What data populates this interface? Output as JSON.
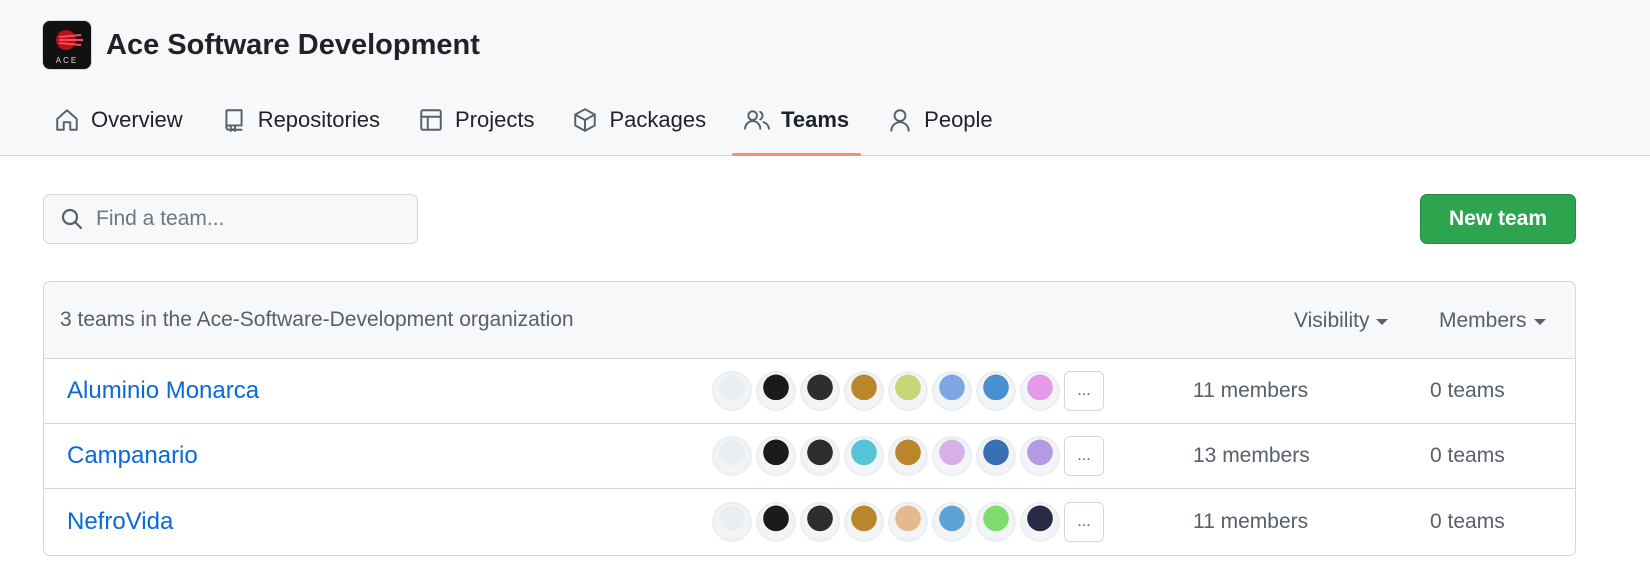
{
  "org": {
    "name": "Ace Software Development",
    "logo_text": "ACE"
  },
  "nav": [
    {
      "label": "Overview",
      "icon": "home-icon"
    },
    {
      "label": "Repositories",
      "icon": "repo-icon"
    },
    {
      "label": "Projects",
      "icon": "table-icon"
    },
    {
      "label": "Packages",
      "icon": "package-icon"
    },
    {
      "label": "Teams",
      "icon": "people-icon",
      "active": true
    },
    {
      "label": "People",
      "icon": "person-icon"
    }
  ],
  "search": {
    "placeholder": "Find a team..."
  },
  "new_team_label": "New team",
  "list": {
    "summary": "3 teams in the Ace-Software-Development organization",
    "filters": {
      "visibility": "Visibility",
      "members": "Members"
    },
    "more_label": "...",
    "teams": [
      {
        "name": "Aluminio Monarca",
        "members": "11 members",
        "child_teams": "0 teams",
        "avatars": [
          "#e8eef2",
          "#1b1b1b",
          "#2d2d2d",
          "#b9862c",
          "#c8d67a",
          "#7fa6e3",
          "#4a8fd1",
          "#e49ae8"
        ]
      },
      {
        "name": "Campanario",
        "members": "13 members",
        "child_teams": "0 teams",
        "avatars": [
          "#e8eef2",
          "#1b1b1b",
          "#2d2d2d",
          "#56c3d6",
          "#b9862c",
          "#d7b0e8",
          "#3b6fb4",
          "#b49ae2"
        ]
      },
      {
        "name": "NefroVida",
        "members": "11 members",
        "child_teams": "0 teams",
        "avatars": [
          "#e8eef2",
          "#1b1b1b",
          "#2d2d2d",
          "#b9862c",
          "#e3b98d",
          "#5fa3d6",
          "#7fdc6c",
          "#2a2a44"
        ]
      }
    ]
  },
  "colors": {
    "accent_underline": "#fd8c73",
    "primary_button": "#2da44e",
    "link": "#0969da"
  }
}
